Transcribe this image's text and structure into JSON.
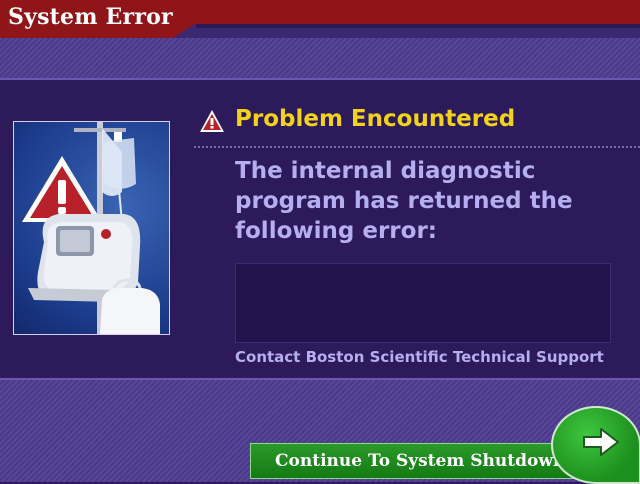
{
  "header": {
    "title": "System Error"
  },
  "dialog": {
    "heading": "Problem Encountered",
    "message": "The internal diagnostic program has returned the following error:",
    "error_text": "",
    "contact": "Contact Boston Scientific Technical Support"
  },
  "actions": {
    "continue_label": "Continue To System Shutdown"
  },
  "icons": {
    "warning": "warning-triangle-icon",
    "continue": "right-arrow-icon"
  },
  "colors": {
    "title_bar": "#8f1518",
    "heading": "#f3d21a",
    "text": "#b5aef0",
    "button": "#1d8f1d",
    "background": "#2c1a5a"
  }
}
